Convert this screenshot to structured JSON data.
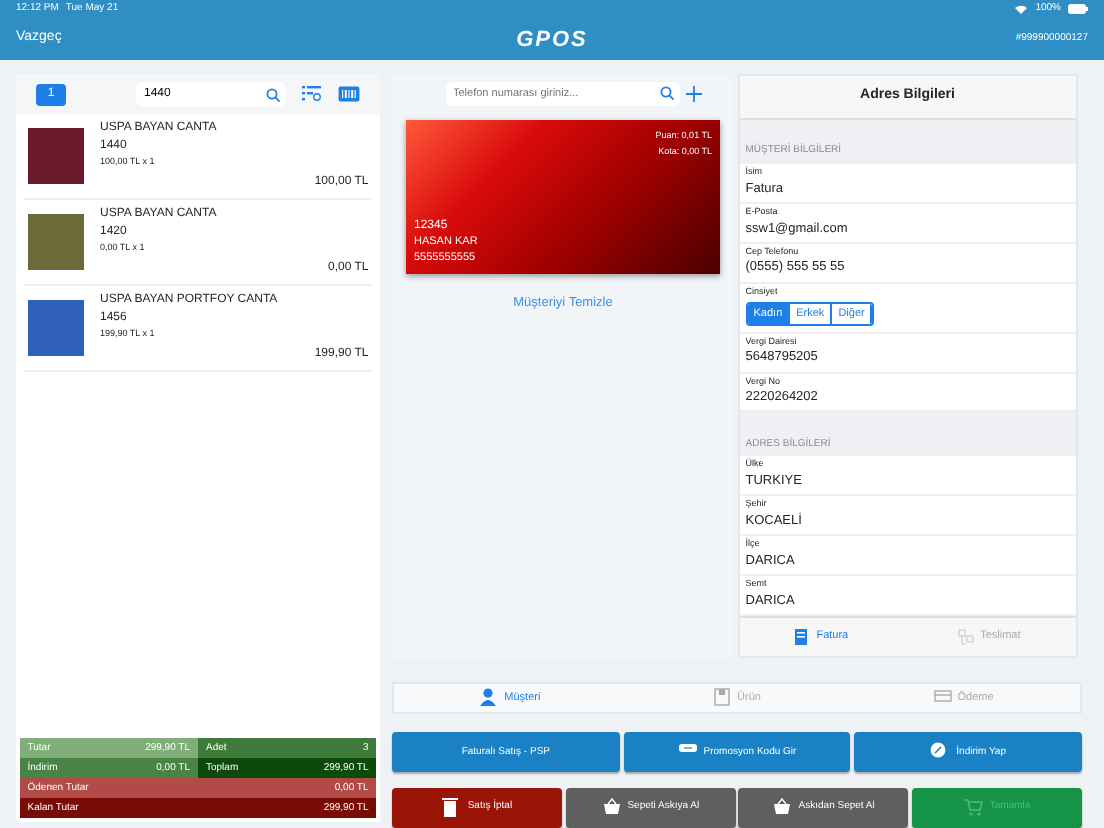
{
  "status_bar": {
    "time": "12:12 PM",
    "date": "Tue May 21",
    "battery": "100%"
  },
  "navbar": {
    "cancel": "Vazgeç",
    "logo": "GPOS",
    "terminal": "#999900000127"
  },
  "cart": {
    "count": "1",
    "search": "1440",
    "items": [
      {
        "name": "USPA BAYAN CANTA",
        "code": "1440",
        "unit": "100,00 TL x 1",
        "total": "100,00 TL"
      },
      {
        "name": "USPA BAYAN CANTA",
        "code": "1420",
        "unit": "0,00 TL x 1",
        "total": "0,00 TL"
      },
      {
        "name": "USPA BAYAN PORTFOY CANTA",
        "code": "1456",
        "unit": "199,90 TL x 1",
        "total": "199,90 TL"
      }
    ],
    "totals": [
      [
        {
          "label": "Tutar",
          "value": "299,90 TL",
          "color": "#7fae78"
        },
        {
          "label": "Adet",
          "value": "3",
          "color": "#3e7a3a"
        }
      ],
      [
        {
          "label": "İndirim",
          "value": "0,00 TL",
          "color": "#4a8444"
        },
        {
          "label": "Toplam",
          "value": "299,90 TL",
          "color": "#0c4a0c"
        }
      ],
      [
        {
          "label": "Ödenen Tutar",
          "value": "0,00 TL",
          "color": "#b24a48"
        }
      ],
      [
        {
          "label": "Kalan Tutar",
          "value": "299,90 TL",
          "color": "#7a0a04"
        }
      ]
    ]
  },
  "customer": {
    "phone_placeholder": "Telefon numarası giriniz...",
    "card": {
      "points": "Puan: 0,01 TL",
      "quota": "Kota: 0,00 TL",
      "number": "12345",
      "name": "HASAN KAR",
      "phone": "5555555555"
    },
    "clear": "Müşteriyi Temizle"
  },
  "address": {
    "title": "Adres Bilgileri",
    "sections": [
      {
        "heading": "MÜŞTERİ BİLGİLERİ",
        "fields": [
          {
            "kind": "text",
            "label": "İsim",
            "value": "Fatura"
          },
          {
            "kind": "text",
            "label": "E-Posta",
            "value": "ssw1@gmail.com"
          },
          {
            "kind": "text",
            "label": "Cep Telefonu",
            "value": "(0555) 555 55 55"
          },
          {
            "kind": "segmented",
            "label": "Cinsiyet",
            "options": [
              {
                "label": "Kadın",
                "selected": true
              },
              {
                "label": "Erkek",
                "selected": false
              },
              {
                "label": "Diğer",
                "selected": false
              }
            ]
          },
          {
            "kind": "text",
            "label": "Vergi Dairesi",
            "value": "5648795205"
          },
          {
            "kind": "text",
            "label": "Vergi No",
            "value": "2220264202"
          }
        ]
      },
      {
        "heading": "ADRES BİLGİLERİ",
        "fields": [
          {
            "kind": "text",
            "label": "Ülke",
            "value": "TURKIYE"
          },
          {
            "kind": "text",
            "label": "Şehir",
            "value": "KOCAELİ"
          },
          {
            "kind": "text",
            "label": "İlçe",
            "value": "DARICA"
          },
          {
            "kind": "text",
            "label": "Semt",
            "value": "DARICA"
          }
        ]
      }
    ],
    "tabs": [
      {
        "kind": "invoice",
        "label": "Fatura",
        "selected": true
      },
      {
        "kind": "delivery",
        "label": "Teslimat",
        "selected": false
      }
    ]
  },
  "bottom_tabs": [
    {
      "kind": "user",
      "label": "Müşteri",
      "selected": true
    },
    {
      "kind": "product",
      "label": "Ürün",
      "selected": false
    },
    {
      "kind": "payment",
      "label": "Ödeme",
      "selected": false
    }
  ],
  "actions": [
    [
      {
        "kind": "none",
        "label": "Faturalı Satış - PSP",
        "color": "#1a82c4",
        "disabled": false
      },
      {
        "kind": "promo",
        "label": "Promosyon Kodu Gir",
        "color": "#1a82c4",
        "disabled": false
      },
      {
        "kind": "discount",
        "label": "İndirim Yap",
        "color": "#1a82c4",
        "disabled": false
      }
    ],
    [
      {
        "kind": "trash",
        "label": "Satış İptal",
        "color": "#9b1408",
        "disabled": false
      },
      {
        "kind": "basket",
        "label": "Sepeti Askıya Al",
        "color": "#5f5f5f",
        "disabled": false
      },
      {
        "kind": "basket",
        "label": "Askıdan Sepet Al",
        "color": "#5f5f5f",
        "disabled": false
      },
      {
        "kind": "cart",
        "label": "Tamamla",
        "color": "#159447",
        "disabled": true
      }
    ]
  ]
}
